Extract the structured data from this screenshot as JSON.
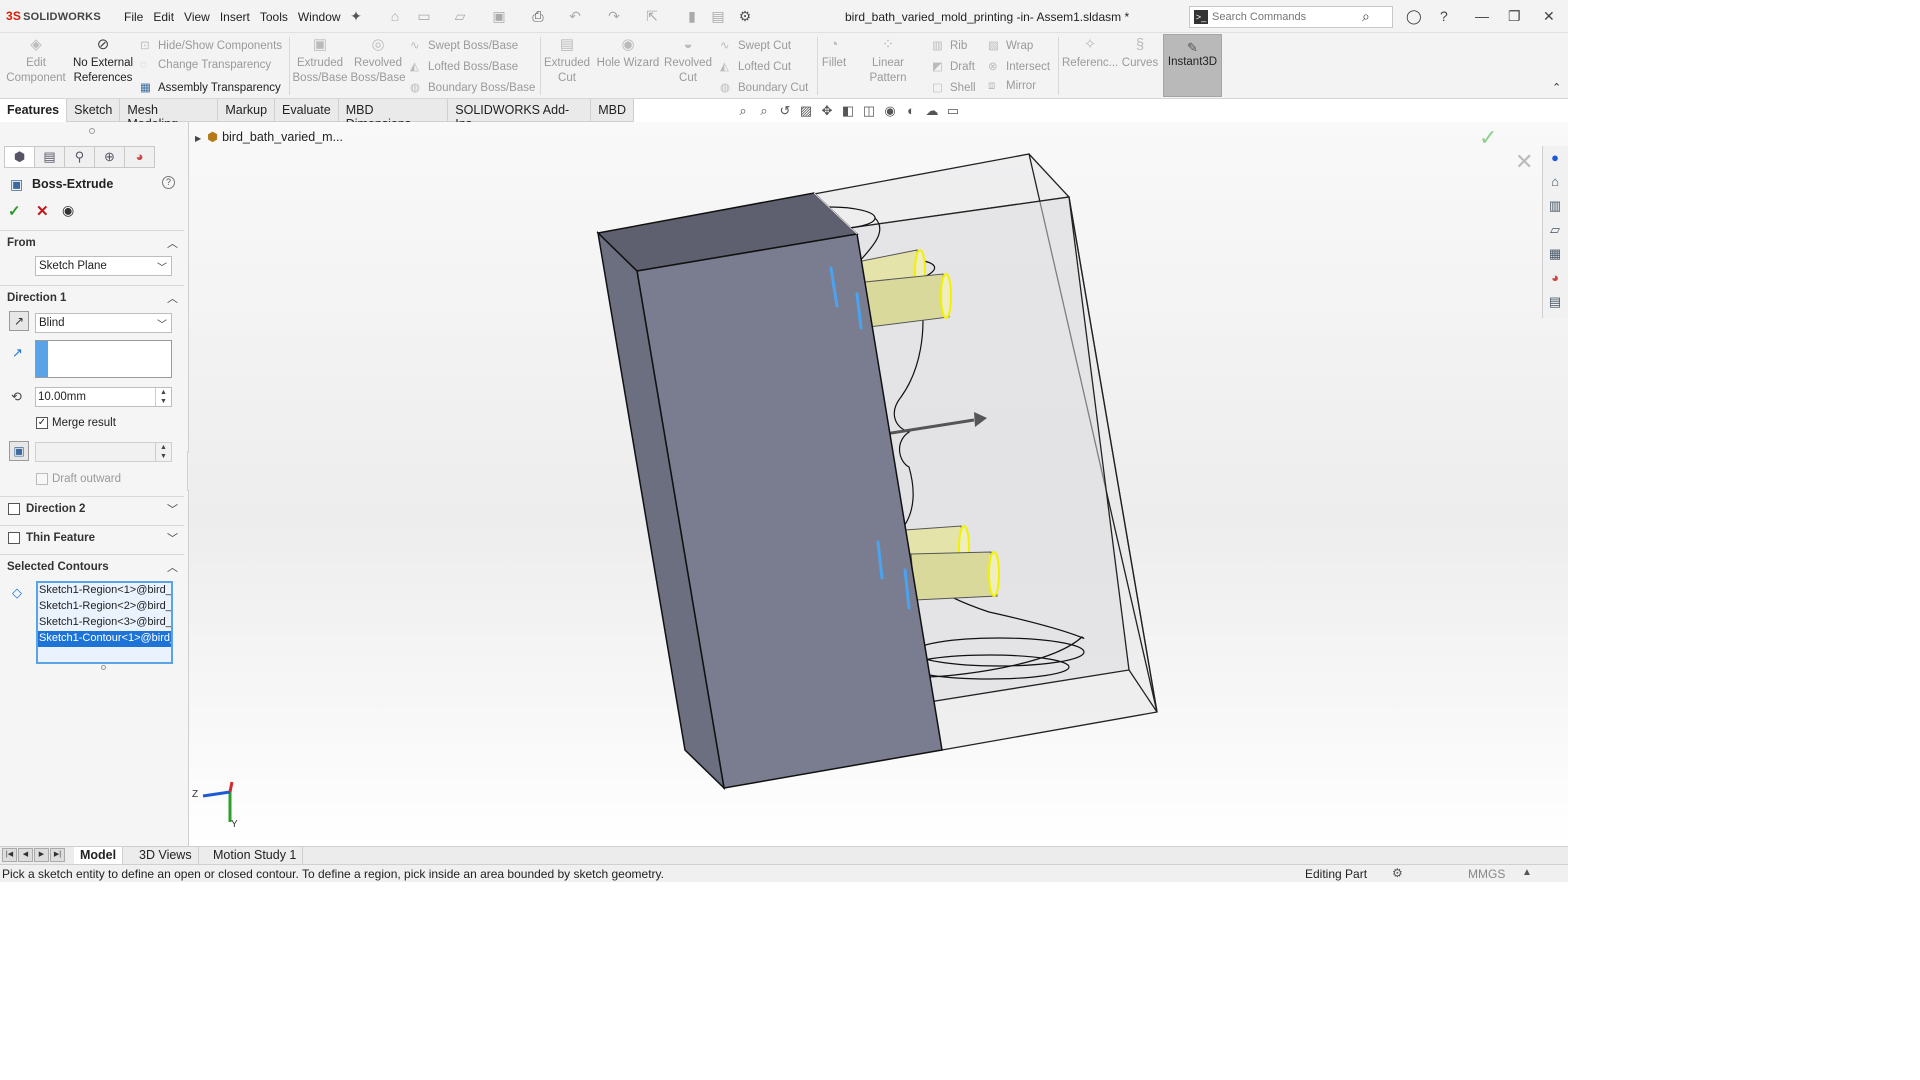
{
  "app": {
    "logo": "SOLIDWORKS",
    "menu": [
      "File",
      "Edit",
      "View",
      "Insert",
      "Tools",
      "Window"
    ],
    "document_title": "bird_bath_varied_mold_printing -in- Assem1.sldasm *",
    "search_placeholder": "Search Commands"
  },
  "ribbon": {
    "edit_component": "Edit Component",
    "no_external_references": "No External References",
    "hide_show_components": "Hide/Show Components",
    "change_transparency": "Change Transparency",
    "assembly_transparency": "Assembly Transparency",
    "extruded_boss": "Extruded Boss/Base",
    "revolved_boss": "Revolved Boss/Base",
    "swept_boss": "Swept Boss/Base",
    "lofted_boss": "Lofted Boss/Base",
    "boundary_boss": "Boundary Boss/Base",
    "extruded_cut": "Extruded Cut",
    "hole_wizard": "Hole Wizard",
    "revolved_cut": "Revolved Cut",
    "swept_cut": "Swept Cut",
    "lofted_cut": "Lofted Cut",
    "boundary_cut": "Boundary Cut",
    "fillet": "Fillet",
    "linear_pattern": "Linear Pattern",
    "rib": "Rib",
    "draft": "Draft",
    "shell": "Shell",
    "wrap": "Wrap",
    "intersect": "Intersect",
    "mirror": "Mirror",
    "reference": "Referenc...",
    "curves": "Curves",
    "instant3d": "Instant3D"
  },
  "tabs": [
    "Features",
    "Sketch",
    "Mesh Modeling",
    "Markup",
    "Evaluate",
    "MBD Dimensions",
    "SOLIDWORKS Add-Ins",
    "MBD"
  ],
  "property_manager": {
    "title": "Boss-Extrude",
    "from_label": "From",
    "from_value": "Sketch Plane",
    "direction1_label": "Direction 1",
    "end_condition": "Blind",
    "depth": "10.00mm",
    "merge_result": "Merge result",
    "draft_outward": "Draft outward",
    "direction2_label": "Direction 2",
    "thin_feature_label": "Thin Feature",
    "selected_contours_label": "Selected Contours",
    "contours": [
      "Sketch1-Region<1>@bird_b",
      "Sketch1-Region<2>@bird_b",
      "Sketch1-Region<3>@bird_b",
      "Sketch1-Contour<1>@bird_"
    ]
  },
  "viewport": {
    "tree_root": "bird_bath_varied_m...",
    "triad_z": "Z",
    "triad_y": "Y"
  },
  "bottom_tabs": [
    "Model",
    "3D Views",
    "Motion Study 1"
  ],
  "status": {
    "message": "Pick a sketch entity to define an open or closed contour. To define a region, pick inside an area bounded by sketch geometry.",
    "mode": "Editing Part",
    "units": "MMGS"
  },
  "colors": {
    "selection_blue": "#1e73d6",
    "solid_face": "#7a7d8f",
    "pin_yellow": "#e6e6a6"
  }
}
